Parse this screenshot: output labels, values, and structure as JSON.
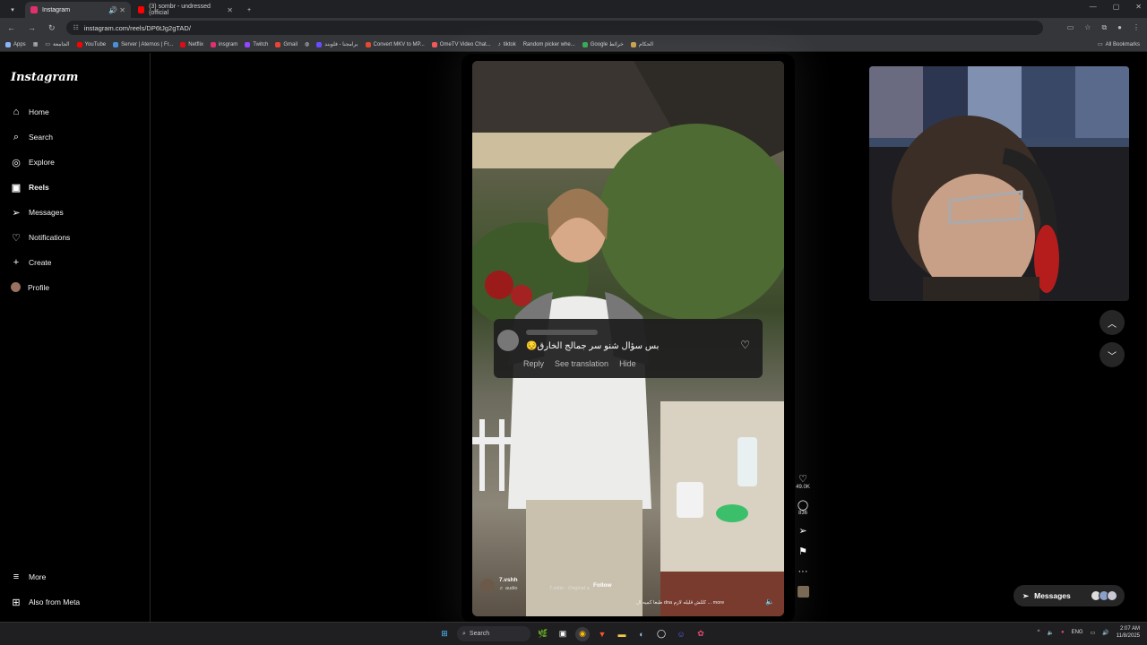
{
  "browser": {
    "tabs": [
      {
        "title": "Instagram",
        "color": "#e1306c",
        "active": true
      },
      {
        "title": "(3) sombr - undressed (official",
        "color": "#ff0000",
        "active": false
      }
    ],
    "new_tab": "+",
    "url": "instagram.com/reels/DP6tJg2gTAD/",
    "bookmarks": [
      {
        "label": "Apps",
        "color": "#8ab4f8"
      },
      {
        "label": "الجامعة",
        "color": "#888"
      },
      {
        "label": "YouTube",
        "color": "#ff0000"
      },
      {
        "label": "Server | Aternos | Fr...",
        "color": "#4a90d9"
      },
      {
        "label": "Netflix",
        "color": "#e50914"
      },
      {
        "label": "insgram",
        "color": "#e1306c"
      },
      {
        "label": "Twitch",
        "color": "#9146ff"
      },
      {
        "label": "Gmail",
        "color": "#ea4335"
      },
      {
        "label": "",
        "color": "#aaa"
      },
      {
        "label": "برامجنا - فلوبند",
        "color": "#6a4cff"
      },
      {
        "label": "Convert MKV to MP...",
        "color": "#e34a2f"
      },
      {
        "label": "OmeTV Video Chat...",
        "color": "#f05a5a"
      },
      {
        "label": "tiktok",
        "color": "#111"
      },
      {
        "label": "Random picker whe...",
        "color": "#333"
      },
      {
        "label": "Google خرائط",
        "color": "#34a853"
      },
      {
        "label": "الحكام",
        "color": "#c8a24a"
      }
    ],
    "all_bookmarks": "All Bookmarks"
  },
  "sidebar": {
    "logo": "Instagram",
    "items": [
      {
        "label": "Home",
        "icon": "home-icon",
        "glyph": "⌂"
      },
      {
        "label": "Search",
        "icon": "search-icon",
        "glyph": "⌕"
      },
      {
        "label": "Explore",
        "icon": "explore-icon",
        "glyph": "◎"
      },
      {
        "label": "Reels",
        "icon": "reels-icon",
        "glyph": "▣"
      },
      {
        "label": "Messages",
        "icon": "messages-icon",
        "glyph": "➢"
      },
      {
        "label": "Notifications",
        "icon": "heart-icon",
        "glyph": "♡"
      },
      {
        "label": "Create",
        "icon": "plus-icon",
        "glyph": "+"
      },
      {
        "label": "Profile",
        "icon": "avatar",
        "glyph": ""
      }
    ],
    "more": "More",
    "also_from_meta": "Also from Meta"
  },
  "reel": {
    "comment": {
      "text": "بس سؤال شنو سر جمالج الخارق😔",
      "reply": "Reply",
      "see_translation": "See translation",
      "hide": "Hide"
    },
    "author": "7.vshh",
    "audio": "♬ audio",
    "audio_credit": "7.vshh · Original a",
    "follow": "Follow",
    "caption": "طبعا كميه ال dna كللش قليله لازم ... more",
    "likes": "49.0K",
    "comments": "836",
    "more_dots": "···"
  },
  "messages_pill": {
    "label": "Messages"
  },
  "taskbar": {
    "search": "Search",
    "lang": "ENG",
    "time": "2:07 AM",
    "date": "11/8/2025"
  }
}
